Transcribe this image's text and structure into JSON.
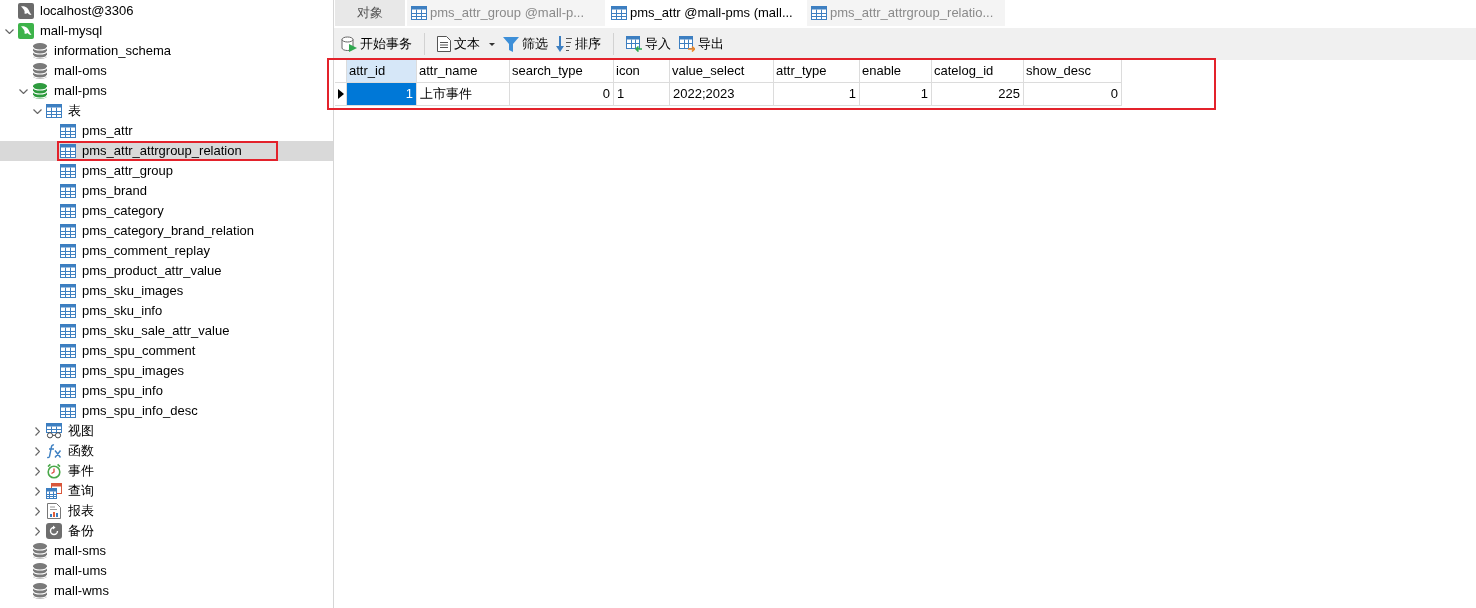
{
  "sidebar": {
    "tree": [
      {
        "name": "localhost@3306",
        "kind": "connection",
        "connected": false,
        "selected": false
      },
      {
        "name": "mall-mysql",
        "kind": "connection",
        "connected": true,
        "expanded": true,
        "selected": false,
        "children": [
          {
            "name": "information_schema",
            "kind": "database",
            "open": false,
            "selected": false
          },
          {
            "name": "mall-oms",
            "kind": "database",
            "open": false,
            "selected": false
          },
          {
            "name": "mall-pms",
            "kind": "database",
            "open": true,
            "expanded": true,
            "selected": false,
            "children": [
              {
                "name": "表",
                "kind": "tables",
                "expanded": true,
                "selected": false,
                "children": [
                  {
                    "name": "pms_attr",
                    "kind": "table",
                    "selected": false
                  },
                  {
                    "name": "pms_attr_attrgroup_relation",
                    "kind": "table",
                    "selected": true,
                    "annotated": true
                  },
                  {
                    "name": "pms_attr_group",
                    "kind": "table",
                    "selected": false
                  },
                  {
                    "name": "pms_brand",
                    "kind": "table",
                    "selected": false
                  },
                  {
                    "name": "pms_category",
                    "kind": "table",
                    "selected": false
                  },
                  {
                    "name": "pms_category_brand_relation",
                    "kind": "table",
                    "selected": false
                  },
                  {
                    "name": "pms_comment_replay",
                    "kind": "table",
                    "selected": false
                  },
                  {
                    "name": "pms_product_attr_value",
                    "kind": "table",
                    "selected": false
                  },
                  {
                    "name": "pms_sku_images",
                    "kind": "table",
                    "selected": false
                  },
                  {
                    "name": "pms_sku_info",
                    "kind": "table",
                    "selected": false
                  },
                  {
                    "name": "pms_sku_sale_attr_value",
                    "kind": "table",
                    "selected": false
                  },
                  {
                    "name": "pms_spu_comment",
                    "kind": "table",
                    "selected": false
                  },
                  {
                    "name": "pms_spu_images",
                    "kind": "table",
                    "selected": false
                  },
                  {
                    "name": "pms_spu_info",
                    "kind": "table",
                    "selected": false
                  },
                  {
                    "name": "pms_spu_info_desc",
                    "kind": "table",
                    "selected": false
                  }
                ]
              },
              {
                "name": "视图",
                "kind": "views",
                "expanded": false,
                "selected": false
              },
              {
                "name": "函数",
                "kind": "functions",
                "expanded": false,
                "selected": false
              },
              {
                "name": "事件",
                "kind": "events",
                "expanded": false,
                "selected": false
              },
              {
                "name": "查询",
                "kind": "queries",
                "expanded": false,
                "selected": false
              },
              {
                "name": "报表",
                "kind": "reports",
                "expanded": false,
                "selected": false
              },
              {
                "name": "备份",
                "kind": "backups",
                "expanded": false,
                "selected": false
              }
            ]
          },
          {
            "name": "mall-sms",
            "kind": "database",
            "open": false,
            "selected": false
          },
          {
            "name": "mall-ums",
            "kind": "database",
            "open": false,
            "selected": false
          },
          {
            "name": "mall-wms",
            "kind": "database",
            "open": false,
            "selected": false
          }
        ]
      }
    ]
  },
  "tabs": [
    {
      "label": "对象",
      "kind": "objects",
      "selected": false
    },
    {
      "label": "pms_attr_group @mall-p...",
      "kind": "table",
      "selected": false
    },
    {
      "label": "pms_attr @mall-pms (mall...",
      "kind": "table",
      "selected": true
    },
    {
      "label": "pms_attr_attrgroup_relatio...",
      "kind": "table",
      "selected": false
    }
  ],
  "toolbar": [
    {
      "kind": "begin_transaction",
      "label": "开始事务"
    },
    {
      "kind": "separator"
    },
    {
      "kind": "text",
      "label": "文本",
      "has_menu": true
    },
    {
      "kind": "filter",
      "label": "筛选"
    },
    {
      "kind": "sort",
      "label": "排序"
    },
    {
      "kind": "separator"
    },
    {
      "kind": "import",
      "label": "导入"
    },
    {
      "kind": "export",
      "label": "导出"
    }
  ],
  "grid": {
    "annotated": true,
    "columns": [
      {
        "label": "attr_id",
        "kind": "number",
        "selected": true
      },
      {
        "label": "attr_name",
        "kind": "text",
        "selected": false
      },
      {
        "label": "search_type",
        "kind": "number",
        "selected": false
      },
      {
        "label": "icon",
        "kind": "text",
        "selected": false
      },
      {
        "label": "value_select",
        "kind": "text",
        "selected": false
      },
      {
        "label": "attr_type",
        "kind": "number",
        "selected": false
      },
      {
        "label": "enable",
        "kind": "number",
        "selected": false
      },
      {
        "label": "catelog_id",
        "kind": "number",
        "selected": false
      },
      {
        "label": "show_desc",
        "kind": "number",
        "selected": false
      }
    ],
    "rows": [
      {
        "current": true,
        "cells": [
          {
            "value": "1",
            "selected": true
          },
          {
            "value": "上市事件",
            "selected": false
          },
          {
            "value": "0",
            "selected": false
          },
          {
            "value": "1",
            "selected": false
          },
          {
            "value": "2022;2023",
            "selected": false
          },
          {
            "value": "1",
            "selected": false
          },
          {
            "value": "1",
            "selected": false
          },
          {
            "value": "225",
            "selected": false
          },
          {
            "value": "0",
            "selected": false
          }
        ]
      }
    ]
  }
}
